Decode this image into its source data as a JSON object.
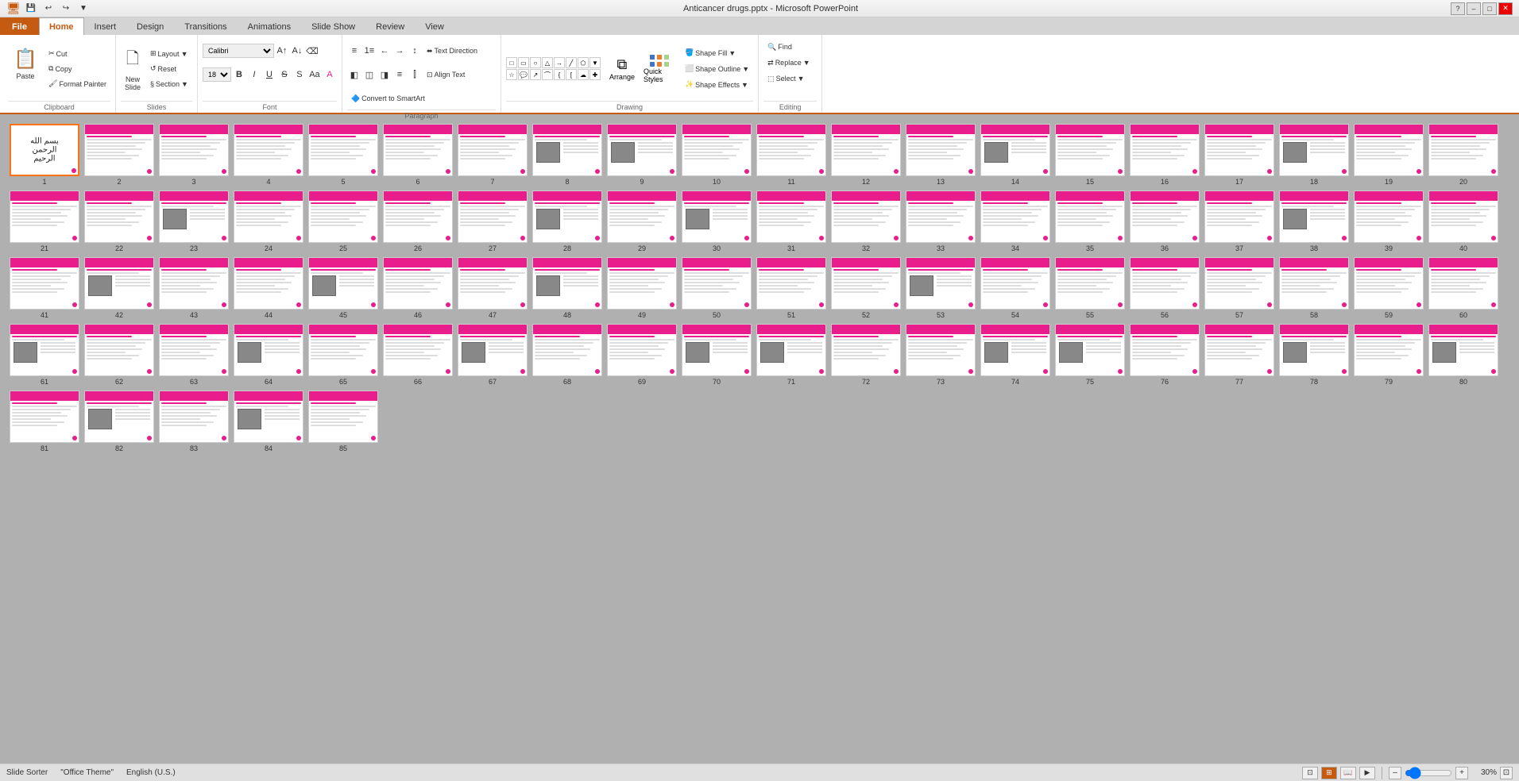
{
  "titlebar": {
    "title": "Anticancer drugs.pptx - Microsoft PowerPoint",
    "win_controls": [
      "–",
      "□",
      "✕"
    ]
  },
  "qat": {
    "buttons": [
      "💾",
      "↩",
      "↪",
      "⬜"
    ]
  },
  "ribbon": {
    "tabs": [
      "File",
      "Home",
      "Insert",
      "Design",
      "Transitions",
      "Animations",
      "Slide Show",
      "Review",
      "View"
    ],
    "active_tab": "Home",
    "groups": {
      "clipboard": {
        "label": "Clipboard",
        "paste_label": "Paste",
        "cut_label": "Cut",
        "copy_label": "Copy",
        "format_painter_label": "Format Painter"
      },
      "slides": {
        "label": "Slides",
        "new_slide_label": "New\nSlide",
        "layout_label": "Layout",
        "reset_label": "Reset",
        "section_label": "Section"
      },
      "font": {
        "label": "Font",
        "font_name": "Calibri",
        "font_size": "18",
        "bold": "B",
        "italic": "I",
        "underline": "U",
        "strikethrough": "S",
        "shadow": "S",
        "increase_font": "A↑",
        "decrease_font": "A↓",
        "change_case": "Aa",
        "font_color": "A"
      },
      "paragraph": {
        "label": "Paragraph",
        "bullets": "≡",
        "numbering": "1≡",
        "decrease_indent": "←",
        "increase_indent": "→",
        "line_spacing": "↕",
        "align_left": "≡",
        "align_center": "≡",
        "align_right": "≡",
        "justify": "≡",
        "cols": "⫿",
        "text_direction_label": "Text Direction",
        "align_text_label": "Align Text",
        "convert_smartart_label": "Convert to SmartArt"
      },
      "drawing": {
        "label": "Drawing",
        "shapes": [
          "□",
          "○",
          "△",
          "▷",
          "⬠",
          "⬡",
          "⬦",
          "⬧",
          "╱",
          "╲",
          "↗",
          "↘",
          "⟵",
          "⟶",
          "⟷",
          "↑",
          "↓",
          "↕",
          "↖",
          "↗",
          "↙",
          "↘",
          "⊓",
          "⊔"
        ],
        "arrange_label": "Arrange",
        "quick_styles_label": "Quick Styles",
        "shape_fill_label": "Shape Fill",
        "shape_outline_label": "Shape Outline",
        "shape_effects_label": "Shape Effects"
      },
      "editing": {
        "label": "Editing",
        "find_label": "Find",
        "replace_label": "Replace",
        "select_label": "Select"
      }
    }
  },
  "slides": {
    "total": 85,
    "selected": 1,
    "thumbnails": [
      {
        "num": 1,
        "type": "title"
      },
      {
        "num": 2,
        "type": "content"
      },
      {
        "num": 3,
        "type": "content"
      },
      {
        "num": 4,
        "type": "content"
      },
      {
        "num": 5,
        "type": "content"
      },
      {
        "num": 6,
        "type": "content"
      },
      {
        "num": 7,
        "type": "content"
      },
      {
        "num": 8,
        "type": "image"
      },
      {
        "num": 9,
        "type": "image"
      },
      {
        "num": 10,
        "type": "content"
      },
      {
        "num": 11,
        "type": "content"
      },
      {
        "num": 12,
        "type": "content"
      },
      {
        "num": 13,
        "type": "content"
      },
      {
        "num": 14,
        "type": "image"
      },
      {
        "num": 15,
        "type": "content"
      },
      {
        "num": 16,
        "type": "content"
      },
      {
        "num": 17,
        "type": "content"
      },
      {
        "num": 18,
        "type": "image"
      },
      {
        "num": 19,
        "type": "content"
      },
      {
        "num": 20,
        "type": "content"
      },
      {
        "num": 21,
        "type": "content"
      },
      {
        "num": 22,
        "type": "content"
      },
      {
        "num": 23,
        "type": "image"
      },
      {
        "num": 24,
        "type": "content"
      },
      {
        "num": 25,
        "type": "content"
      },
      {
        "num": 26,
        "type": "content"
      },
      {
        "num": 27,
        "type": "content"
      },
      {
        "num": 28,
        "type": "image"
      },
      {
        "num": 29,
        "type": "content"
      },
      {
        "num": 30,
        "type": "image"
      },
      {
        "num": 31,
        "type": "content"
      },
      {
        "num": 32,
        "type": "content"
      },
      {
        "num": 33,
        "type": "content"
      },
      {
        "num": 34,
        "type": "content"
      },
      {
        "num": 35,
        "type": "content"
      },
      {
        "num": 36,
        "type": "content"
      },
      {
        "num": 37,
        "type": "content"
      },
      {
        "num": 38,
        "type": "image"
      },
      {
        "num": 39,
        "type": "content"
      },
      {
        "num": 40,
        "type": "content"
      },
      {
        "num": 41,
        "type": "content"
      },
      {
        "num": 42,
        "type": "image"
      },
      {
        "num": 43,
        "type": "content"
      },
      {
        "num": 44,
        "type": "content"
      },
      {
        "num": 45,
        "type": "image"
      },
      {
        "num": 46,
        "type": "content"
      },
      {
        "num": 47,
        "type": "content"
      },
      {
        "num": 48,
        "type": "image"
      },
      {
        "num": 49,
        "type": "content"
      },
      {
        "num": 50,
        "type": "content"
      },
      {
        "num": 51,
        "type": "content"
      },
      {
        "num": 52,
        "type": "content"
      },
      {
        "num": 53,
        "type": "image"
      },
      {
        "num": 54,
        "type": "content"
      },
      {
        "num": 55,
        "type": "content"
      },
      {
        "num": 56,
        "type": "content"
      },
      {
        "num": 57,
        "type": "content"
      },
      {
        "num": 58,
        "type": "content"
      },
      {
        "num": 59,
        "type": "content"
      },
      {
        "num": 60,
        "type": "content"
      },
      {
        "num": 61,
        "type": "image"
      },
      {
        "num": 62,
        "type": "content"
      },
      {
        "num": 63,
        "type": "content"
      },
      {
        "num": 64,
        "type": "image"
      },
      {
        "num": 65,
        "type": "content"
      },
      {
        "num": 66,
        "type": "content"
      },
      {
        "num": 67,
        "type": "image"
      },
      {
        "num": 68,
        "type": "content"
      },
      {
        "num": 69,
        "type": "content"
      },
      {
        "num": 70,
        "type": "image"
      },
      {
        "num": 71,
        "type": "image"
      },
      {
        "num": 72,
        "type": "content"
      },
      {
        "num": 73,
        "type": "content"
      },
      {
        "num": 74,
        "type": "image"
      },
      {
        "num": 75,
        "type": "image"
      },
      {
        "num": 76,
        "type": "content"
      },
      {
        "num": 77,
        "type": "content"
      },
      {
        "num": 78,
        "type": "image"
      },
      {
        "num": 79,
        "type": "content"
      },
      {
        "num": 80,
        "type": "image"
      },
      {
        "num": 81,
        "type": "content"
      },
      {
        "num": 82,
        "type": "image"
      },
      {
        "num": 83,
        "type": "content"
      },
      {
        "num": 84,
        "type": "image"
      },
      {
        "num": 85,
        "type": "content"
      }
    ]
  },
  "statusbar": {
    "slide_sorter_label": "Slide Sorter",
    "theme_label": "\"Office Theme\"",
    "language_label": "English (U.S.)",
    "zoom_level": "30%",
    "view_icons": [
      "normal",
      "slide-sorter",
      "reading",
      "slideshow"
    ]
  }
}
